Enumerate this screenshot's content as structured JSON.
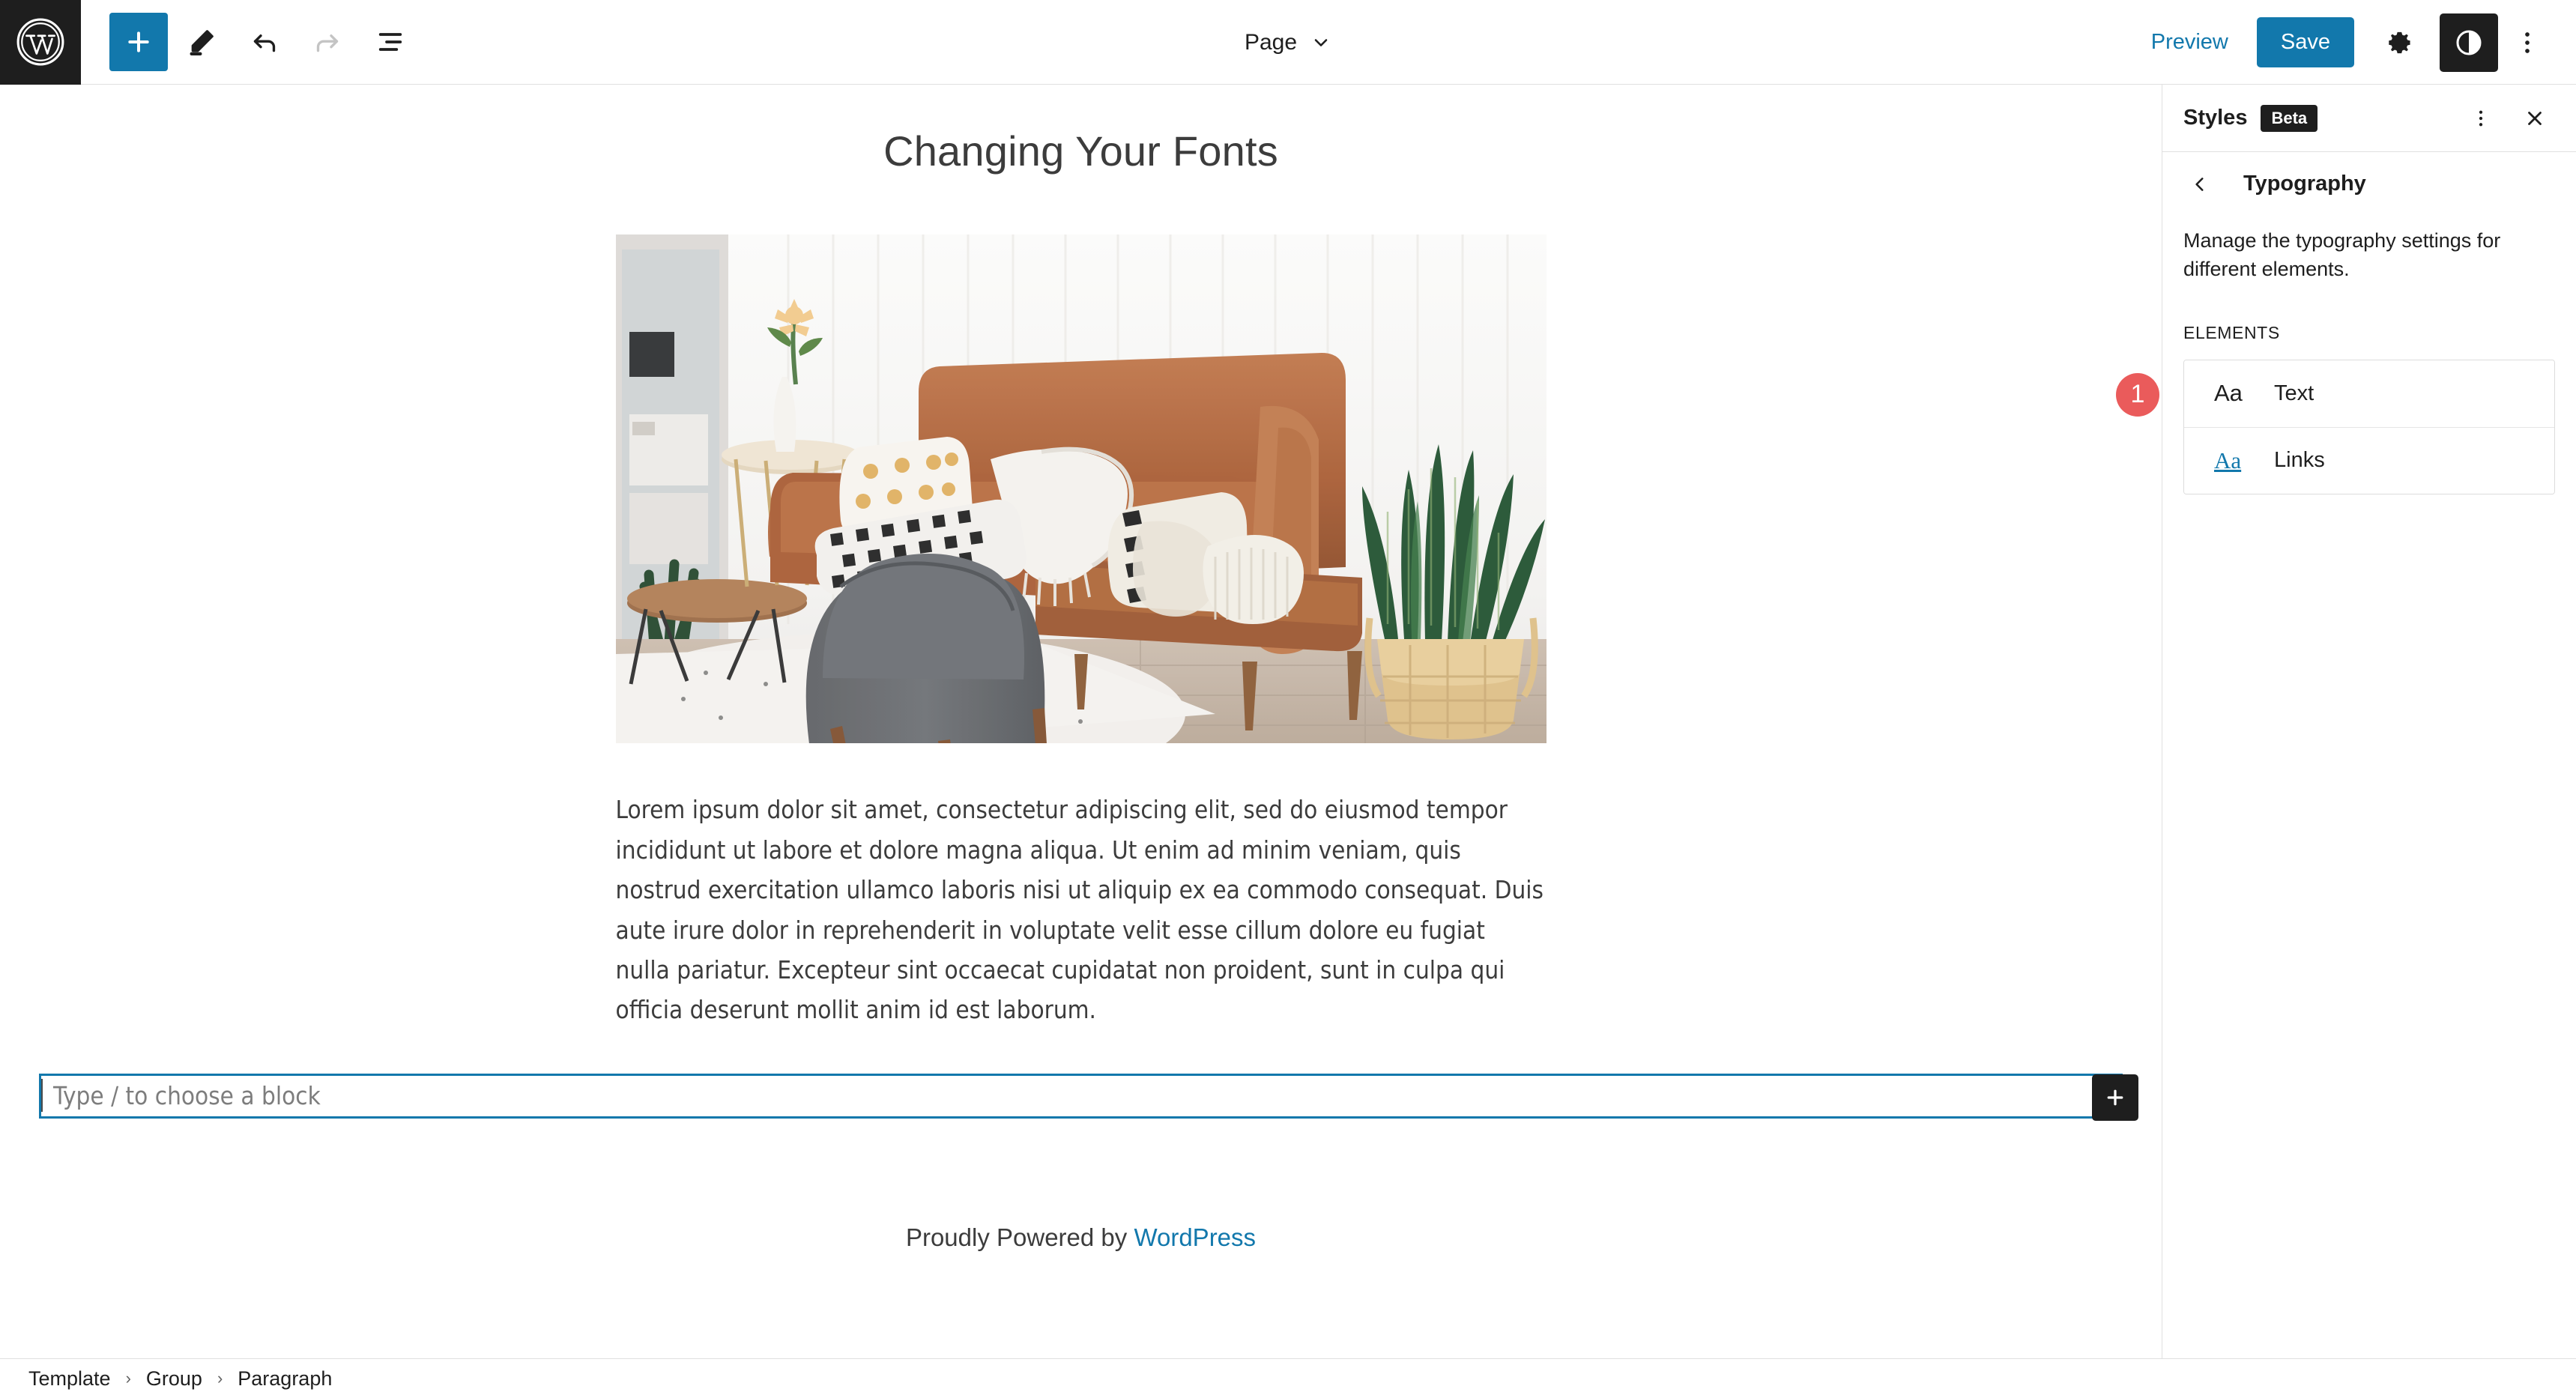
{
  "header": {
    "logo_icon": "wordpress-logo-icon",
    "tools": [
      {
        "name": "add-block-button",
        "icon": "plus-icon",
        "label": "Add block"
      },
      {
        "name": "tools-button",
        "icon": "pencil-icon",
        "label": "Tools"
      },
      {
        "name": "undo-button",
        "icon": "undo-arrow-icon",
        "label": "Undo"
      },
      {
        "name": "redo-button",
        "icon": "redo-arrow-icon",
        "label": "Redo"
      },
      {
        "name": "list-view-button",
        "icon": "list-view-icon",
        "label": "List View"
      }
    ],
    "document_switcher": {
      "label": "Page",
      "icon": "chevron-down-icon"
    },
    "preview_label": "Preview",
    "save_label": "Save",
    "settings_icon": "gear-icon",
    "styles_icon": "contrast-half-circle-icon",
    "options_icon": "kebab-vertical-icon"
  },
  "canvas": {
    "post_title": "Changing Your Fonts",
    "featured_image_alt": "Living room with brown leather sofa, gray armchair, snake plant and white rug",
    "body_paragraph": "Lorem ipsum dolor sit amet, consectetur adipiscing elit, sed do eiusmod tempor incididunt ut labore et dolore magna aliqua. Ut enim ad minim veniam, quis nostrud exercitation ullamco laboris nisi ut aliquip ex ea commodo consequat. Duis aute irure dolor in reprehenderit in voluptate velit esse cillum dolore eu fugiat nulla pariatur. Excepteur sint occaecat cupidatat non proident, sunt in culpa qui officia deserunt mollit anim id est laborum.",
    "empty_block_placeholder": "Type / to choose a block",
    "empty_block_add_icon": "plus-icon",
    "footer_text": "Proudly Powered by ",
    "footer_link": "WordPress"
  },
  "breadcrumb": {
    "items": [
      "Template",
      "Group",
      "Paragraph"
    ],
    "separator": "›"
  },
  "sidebar": {
    "title": "Styles",
    "beta_label": "Beta",
    "more_icon": "kebab-vertical-icon",
    "close_icon": "close-x-icon",
    "back_icon": "chevron-left-icon",
    "nav_title": "Typography",
    "description": "Manage the typography settings for different elements.",
    "section_label": "Elements",
    "elements": [
      {
        "icon_text": "Aa",
        "label": "Text",
        "style": "plain"
      },
      {
        "icon_text": "Aa",
        "label": "Links",
        "style": "link"
      }
    ],
    "step_badge": "1"
  },
  "colors": {
    "accent_blue": "#1278ac",
    "dark": "#1e1e1e",
    "badge_red": "#ea5b5b",
    "border": "#e0e0e0",
    "muted_text": "#7d7d7d"
  }
}
